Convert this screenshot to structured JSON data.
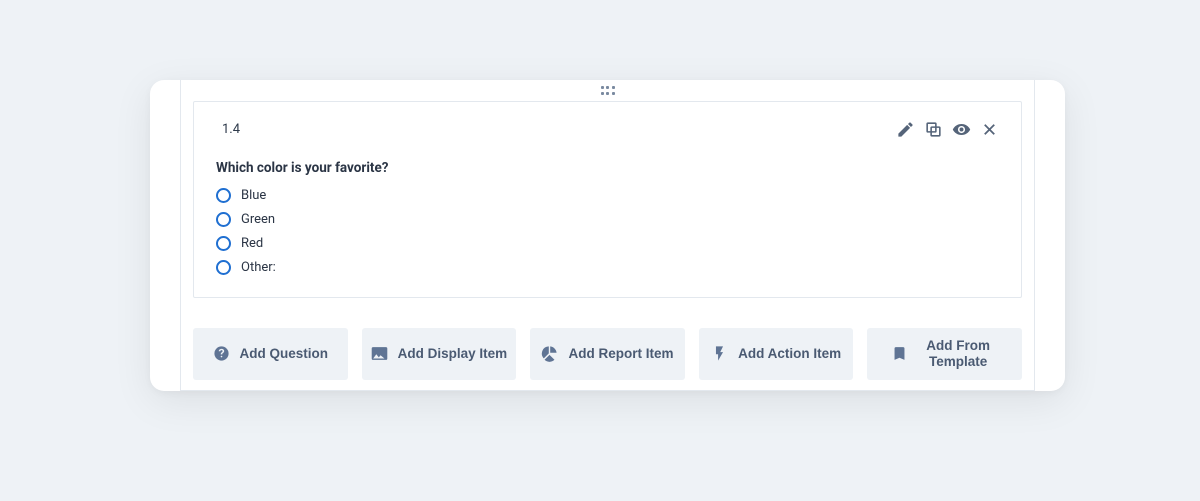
{
  "question": {
    "number": "1.4",
    "prompt": "Which color is your favorite?",
    "options": [
      "Blue",
      "Green",
      "Red",
      "Other:"
    ]
  },
  "actions": {
    "add_question": "Add Question",
    "add_display_item": "Add Display Item",
    "add_report_item": "Add Report Item",
    "add_action_item": "Add Action Item",
    "add_from_template": "Add From Template"
  }
}
